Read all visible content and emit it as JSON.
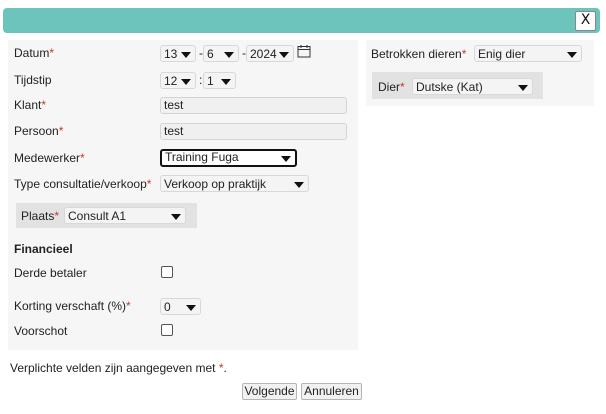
{
  "dialog": {
    "close_label": "X"
  },
  "form": {
    "datum_label": "Datum",
    "datum_day": "13",
    "datum_month": "6",
    "datum_year": "2024",
    "date_sep": "-",
    "tijdstip_label": "Tijdstip",
    "hour": "12",
    "time_sep": ":",
    "minute": "1",
    "klant_label": "Klant",
    "klant_value": "test",
    "persoon_label": "Persoon",
    "persoon_value": "test",
    "medewerker_label": "Medewerker",
    "medewerker_value": "Training Fuga",
    "type_label": "Type consultatie/verkoop",
    "type_value": "Verkoop op praktijk",
    "plaats_label": "Plaats",
    "plaats_value": "Consult A1",
    "financieel_heading": "Financieel",
    "derde_betaler_label": "Derde betaler",
    "korting_label": "Korting verschaft (%)",
    "korting_value": "0",
    "voorschot_label": "Voorschot",
    "required_mark": "*"
  },
  "right": {
    "betrokken_label": "Betrokken dieren",
    "betrokken_value": "Enig dier",
    "dier_label": "Dier",
    "dier_value": "Dutske (Kat)"
  },
  "footer": {
    "note": "Verplichte velden zijn aangegeven met",
    "note_star": "*",
    "note_end": ".",
    "next_label": "Volgende",
    "cancel_label": "Annuleren"
  }
}
